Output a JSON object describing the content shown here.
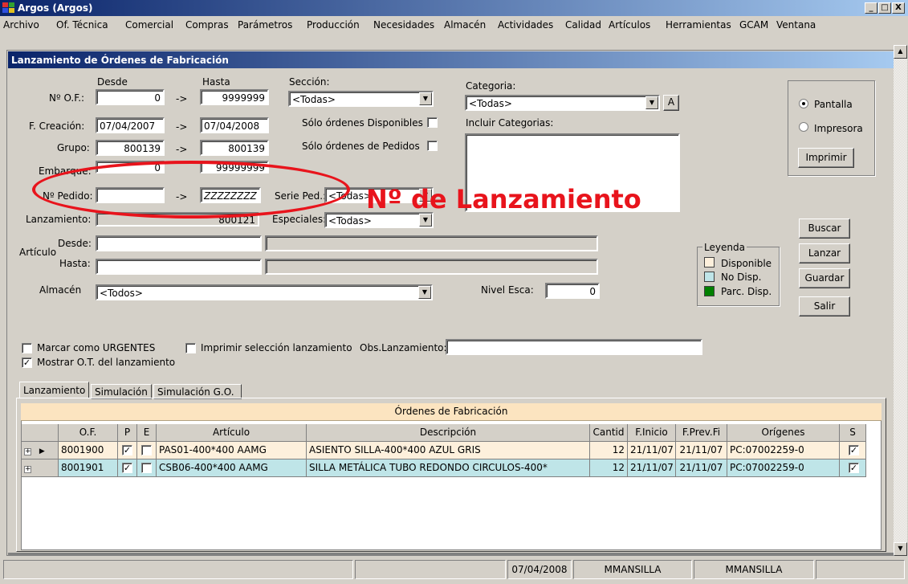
{
  "window": {
    "title": "Argos (Argos)",
    "minimize": "_",
    "restore": "□",
    "close": "X"
  },
  "menu": [
    "Archivo",
    "Of. Técnica",
    "Comercial",
    "Compras",
    "Parámetros",
    "Producción",
    "Necesidades",
    "Almacén",
    "Actividades",
    "Calidad",
    "Artículos",
    "Herramientas",
    "GCAM",
    "Ventana"
  ],
  "form": {
    "title": "Lanzamiento de Órdenes de Fabricación",
    "col_desde": "Desde",
    "col_hasta": "Hasta",
    "arrow": "->",
    "of": {
      "label": "Nº O.F.:",
      "desde": "0",
      "hasta": "9999999"
    },
    "creacion": {
      "label": "F. Creación:",
      "desde": "07/04/2007",
      "hasta": "07/04/2008"
    },
    "grupo": {
      "label": "Grupo:",
      "desde": "800139",
      "hasta": "800139"
    },
    "embarque": {
      "label": "Embarque:",
      "desde": "0",
      "hasta": "99999999"
    },
    "pedido": {
      "label": "Nº Pedido:",
      "desde": "",
      "hasta": "ZZZZZZZZ"
    },
    "lanzamiento": {
      "label": "Lanzamiento:",
      "value": "800121"
    },
    "articulo": {
      "label": "Artículo",
      "desde_label": "Desde:",
      "hasta_label": "Hasta:",
      "desde": "",
      "hasta": "",
      "desde_desc": "",
      "hasta_desc": ""
    },
    "almacen": {
      "label": "Almacén",
      "value": "<Todos>"
    },
    "seccion": {
      "label": "Sección:",
      "value": "<Todas>"
    },
    "solo_disponibles": {
      "label": "Sólo órdenes Disponibles",
      "checked": false
    },
    "solo_pedidos": {
      "label": "Sólo órdenes de Pedidos",
      "checked": false
    },
    "serie_ped": {
      "label": "Serie Ped.:",
      "value": "<Todas>"
    },
    "especiales": {
      "label": "Especiales:",
      "value": "<Todas>"
    },
    "categoria": {
      "label": "Categoria:",
      "value": "<Todas>",
      "btn": "A"
    },
    "incluir_categorias": {
      "label": "Incluir Categorias:"
    },
    "nivel_esca": {
      "label": "Nivel Esca:",
      "value": "0"
    },
    "urgentes": {
      "label": "Marcar como URGENTES",
      "checked": false
    },
    "imprimir_sel": {
      "label": "Imprimir selección lanzamiento",
      "checked": false
    },
    "obs": {
      "label": "Obs.Lanzamiento:",
      "value": ""
    },
    "mostrar_ot": {
      "label": "Mostrar O.T. del lanzamiento",
      "checked": true
    }
  },
  "output": {
    "pantalla": "Pantalla",
    "impresora": "Impresora",
    "selected": "Pantalla",
    "imprimir": "Imprimir"
  },
  "buttons": {
    "buscar": "Buscar",
    "lanzar": "Lanzar",
    "guardar": "Guardar",
    "salir": "Salir"
  },
  "leyenda": {
    "title": "Leyenda",
    "items": [
      {
        "label": "Disponible",
        "color": "#fdf0dc"
      },
      {
        "label": "No Disp.",
        "color": "#bfe5e8"
      },
      {
        "label": "Parc. Disp.",
        "color": "#008000"
      }
    ]
  },
  "tabs": [
    "Lanzamiento",
    "Simulación",
    "Simulación G.O."
  ],
  "grid": {
    "title": "Órdenes de Fabricación",
    "headers": [
      "O.F.",
      "P",
      "E",
      "Artículo",
      "Descripción",
      "Cantid",
      "F.Inicio",
      "F.Prev.Fi",
      "Orígenes",
      "S"
    ],
    "rows": [
      {
        "of": "8001900",
        "p": true,
        "e": false,
        "articulo": "PAS01-400*400 AAMG",
        "descripcion": "ASIENTO SILLA-400*400 AZUL GRIS",
        "cantid": "12",
        "inicio": "21/11/07",
        "prev": "21/11/07",
        "origenes": "PC:07002259-0",
        "s": true
      },
      {
        "of": "8001901",
        "p": true,
        "e": false,
        "articulo": "CSB06-400*400 AAMG",
        "descripcion": "SILLA METÁLICA TUBO REDONDO CIRCULOS-400*",
        "cantid": "12",
        "inicio": "21/11/07",
        "prev": "21/11/07",
        "origenes": "PC:07002259-0",
        "s": true
      }
    ]
  },
  "status": {
    "date": "07/04/2008",
    "user1": "MMANSILLA",
    "user2": "MMANSILLA"
  },
  "annotation": {
    "text": "Nº de Lanzamiento",
    "color": "#e8141c"
  }
}
